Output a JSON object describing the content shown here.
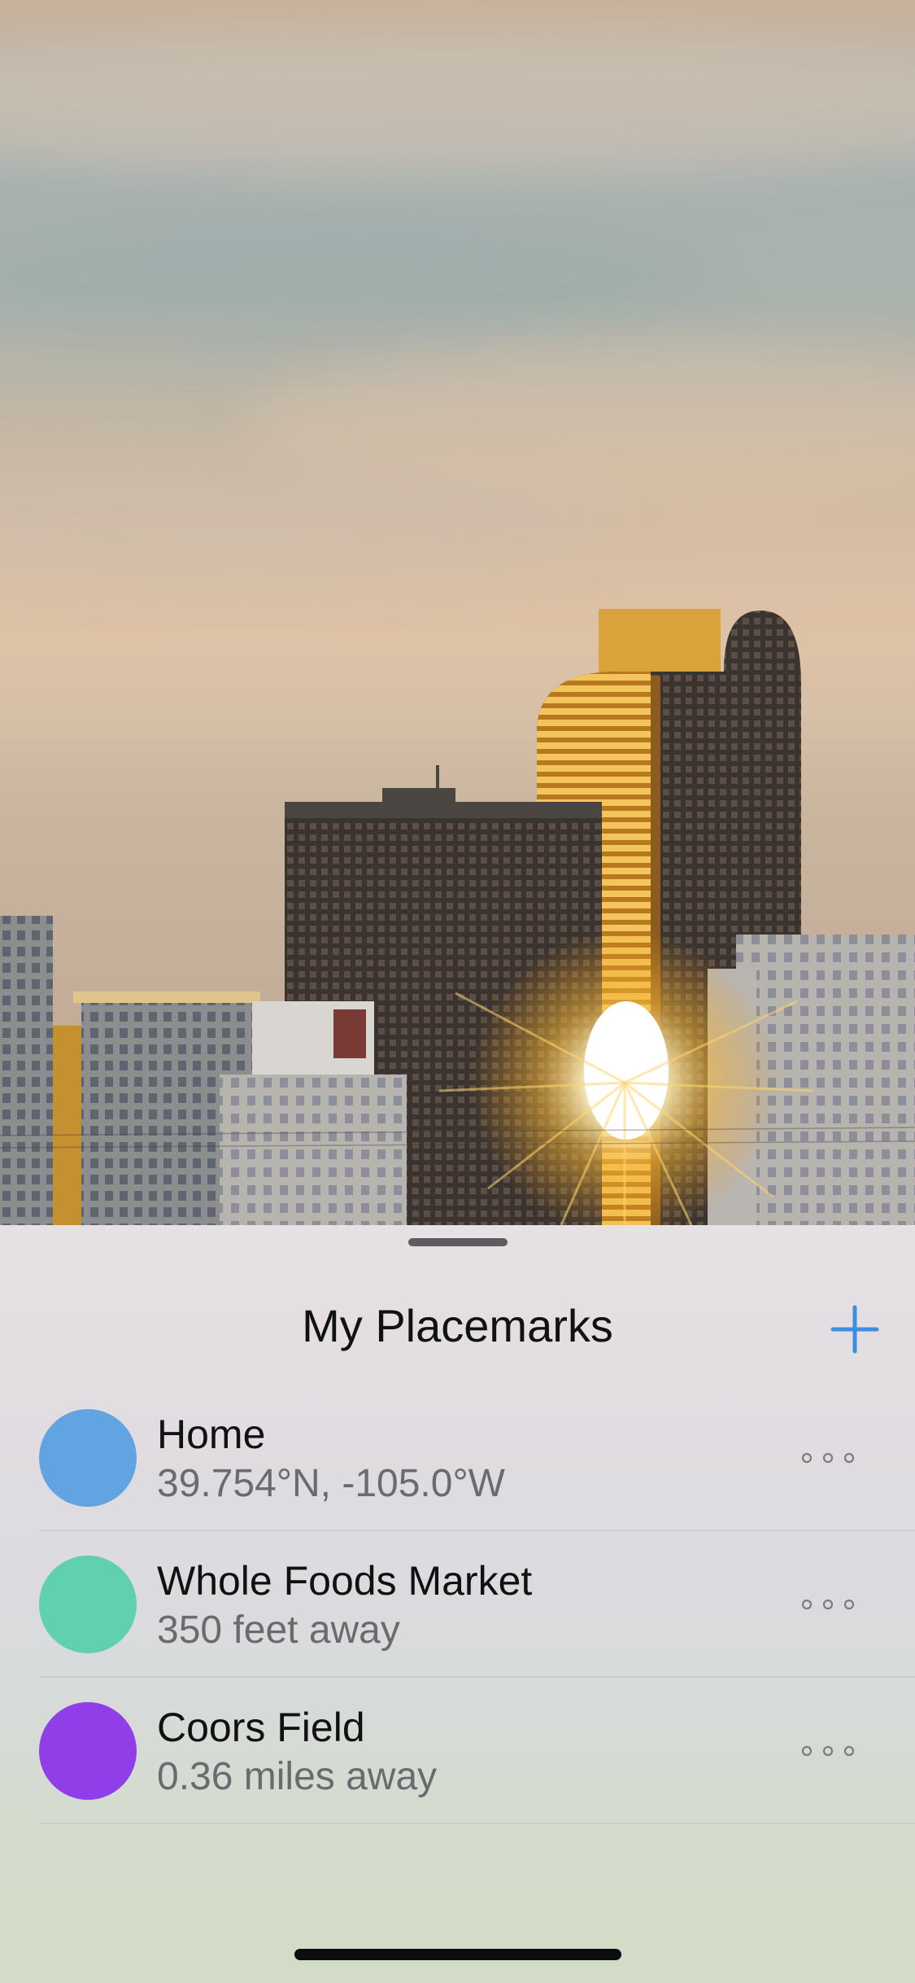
{
  "hero": {
    "image": "sunset-city-skyline-photo"
  },
  "sheet": {
    "title": "My Placemarks",
    "add_icon": "plus-icon",
    "accent_color": "#3b8ee0"
  },
  "placemarks": [
    {
      "name": "Home",
      "detail": "39.754°N, -105.0°W",
      "color": "#62a4e2",
      "menu_icon": "more-horizontal-icon"
    },
    {
      "name": "Whole Foods Market",
      "detail": "350 feet away",
      "color": "#5fd0b0",
      "menu_icon": "more-horizontal-icon"
    },
    {
      "name": "Coors Field",
      "detail": "0.36 miles away",
      "color": "#8f3ee8",
      "menu_icon": "more-horizontal-icon"
    }
  ]
}
